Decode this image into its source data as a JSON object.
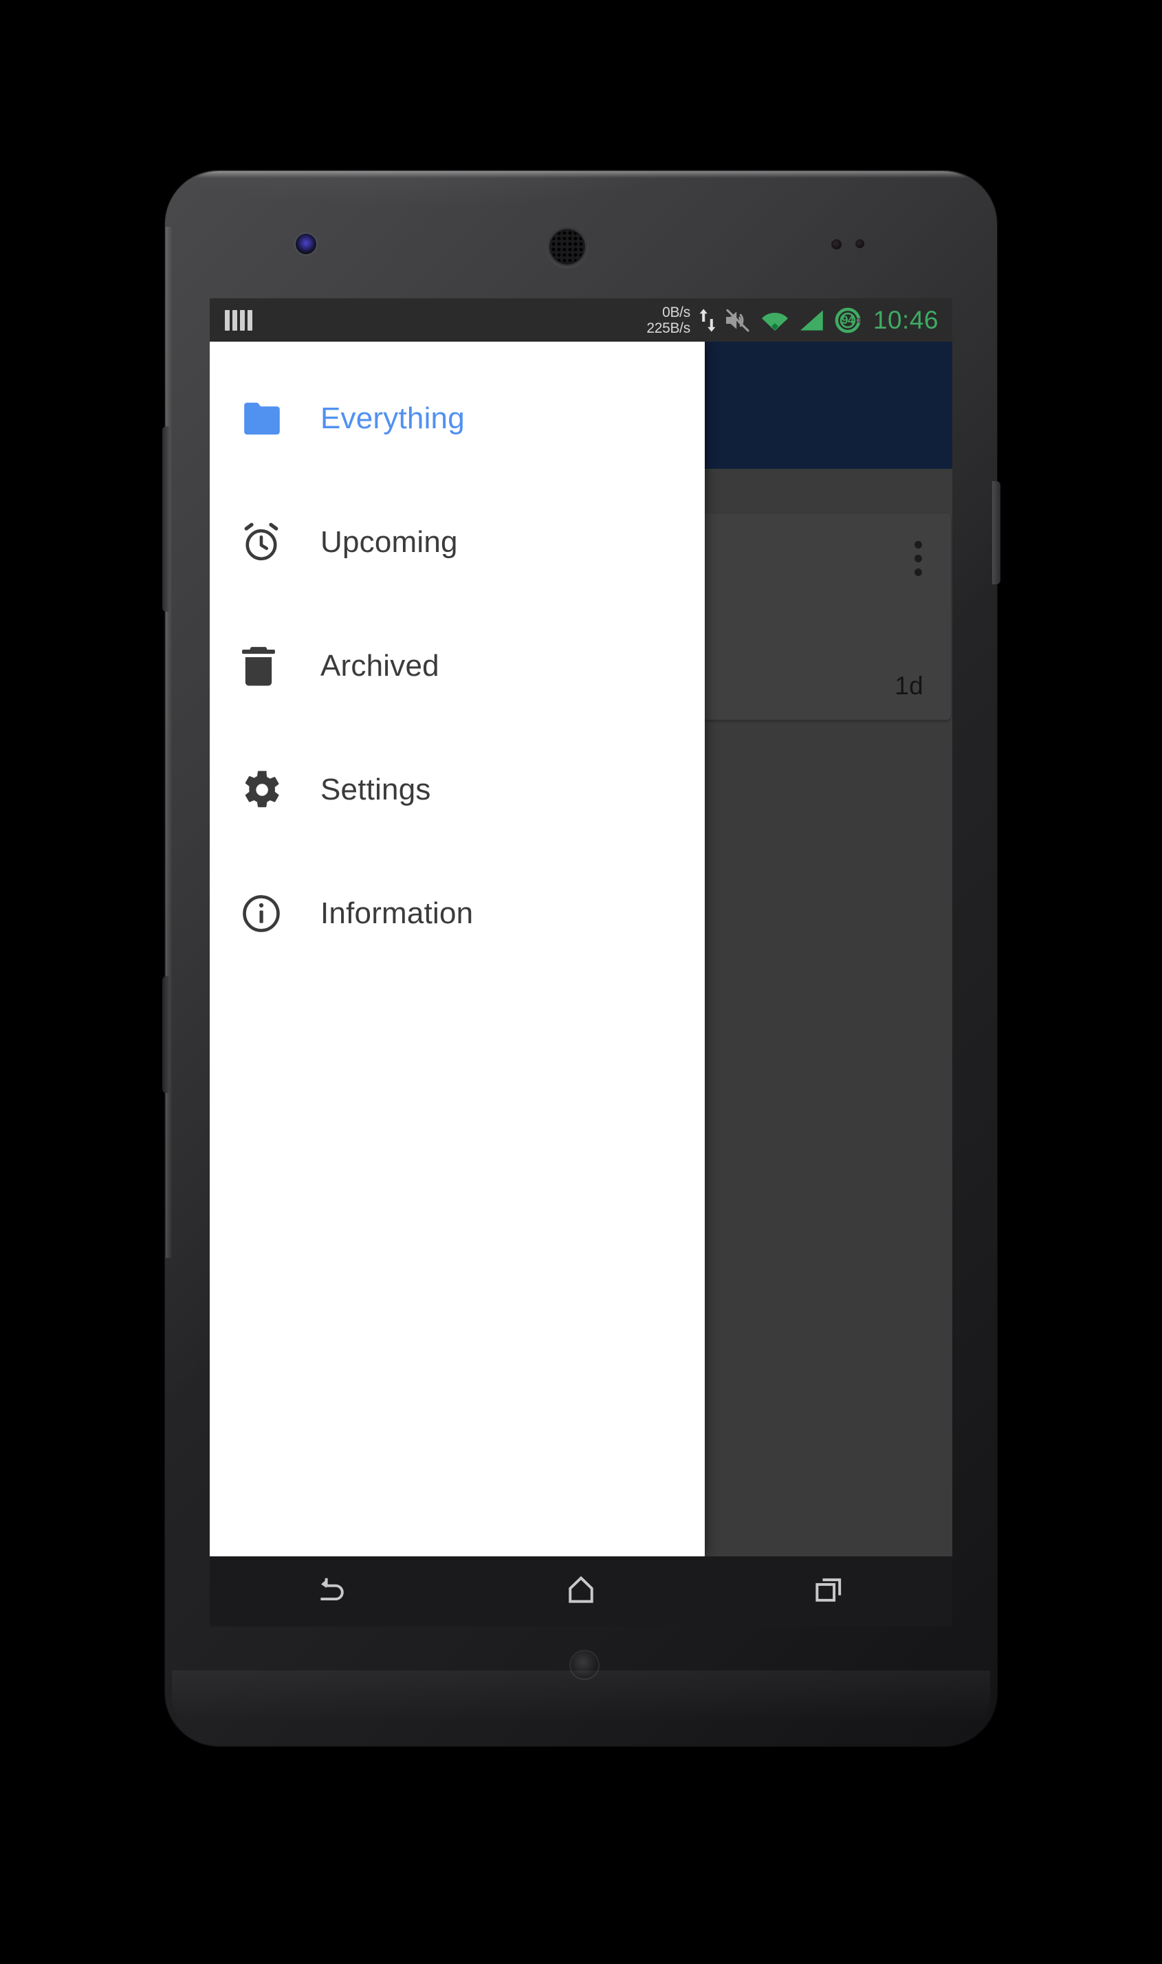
{
  "status_bar": {
    "left_icon": "signal-bars-icon",
    "network_speed_up": "0B/s",
    "network_speed_down": "225B/s",
    "volume_state": "muted",
    "battery_percent": "94",
    "time": "10:46",
    "accent_color": "#3fac63",
    "background_color": "#2b2b2b"
  },
  "drawer": {
    "background_color": "#ffffff",
    "active_color": "#5191f0",
    "items": [
      {
        "label": "Everything",
        "icon": "folder-icon",
        "active": true
      },
      {
        "label": "Upcoming",
        "icon": "alarm-clock-icon",
        "active": false
      },
      {
        "label": "Archived",
        "icon": "trash-icon",
        "active": false
      },
      {
        "label": "Settings",
        "icon": "gear-icon",
        "active": false
      },
      {
        "label": "Information",
        "icon": "info-icon",
        "active": false
      }
    ]
  },
  "app_content": {
    "appbar_color": "#1b3561",
    "scrim_color": "#636363",
    "card": {
      "due_label": "1d",
      "overflow_icon": "overflow-menu-icon"
    }
  },
  "nav_bar": {
    "background_color": "#1a1a1c",
    "buttons": [
      {
        "name": "back",
        "icon": "back-arrow-icon"
      },
      {
        "name": "home",
        "icon": "home-icon"
      },
      {
        "name": "recents",
        "icon": "recents-icon"
      }
    ]
  },
  "device": {
    "hardware": [
      "front-camera",
      "earpiece-speaker",
      "proximity-sensor",
      "power-button",
      "volume-buttons"
    ]
  }
}
